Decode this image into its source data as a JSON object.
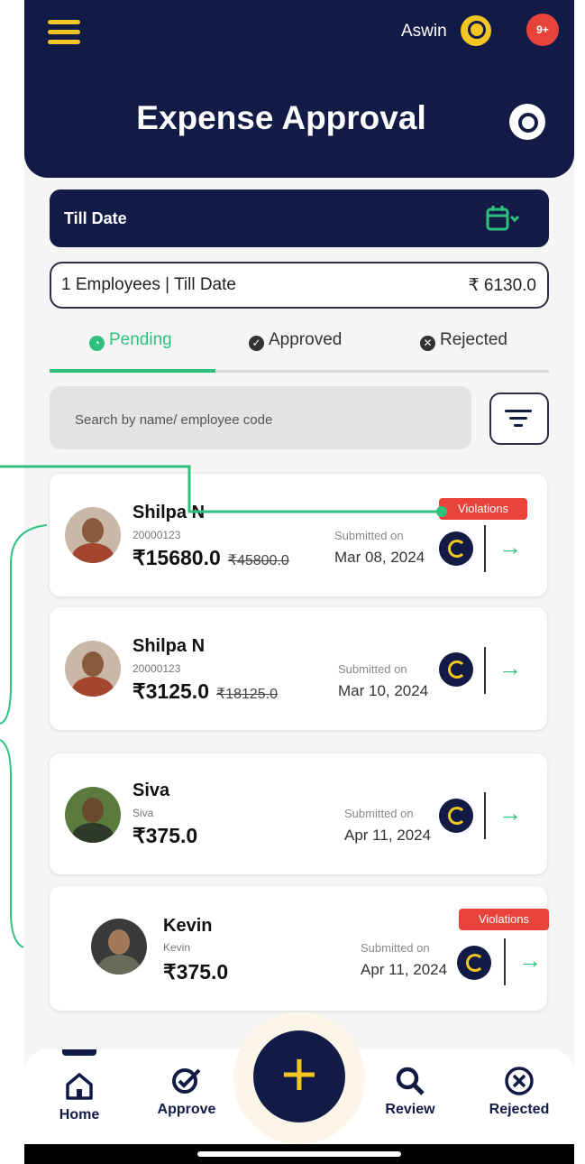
{
  "header": {
    "user_name": "Aswin",
    "notification_badge": "9+",
    "title": "Expense Approval",
    "accent": "#f3c623",
    "brand": "#121b45"
  },
  "date_filter": {
    "label": "Till Date",
    "icon": "calendar-icon"
  },
  "summary": {
    "left": "1 Employees | Till Date",
    "right": "₹ 6130.0"
  },
  "tabs": [
    {
      "label": "Pending",
      "icon": "clock-icon",
      "active": true
    },
    {
      "label": "Approved",
      "icon": "check-circle-icon",
      "active": false
    },
    {
      "label": "Rejected",
      "icon": "x-circle-icon",
      "active": false
    }
  ],
  "search": {
    "placeholder": "Search by name/ employee code"
  },
  "cards": [
    {
      "name": "Shilpa N",
      "code": "20000123",
      "amount": "₹15680.0",
      "original": "₹45800.0",
      "submitted_label": "Submitted on",
      "date": "Mar 08, 2024",
      "violation": "Violations"
    },
    {
      "name": "Shilpa N",
      "code": "20000123",
      "amount": "₹3125.0",
      "original": "₹18125.0",
      "submitted_label": "Submitted on",
      "date": "Mar 10, 2024",
      "violation": ""
    },
    {
      "name": "Siva",
      "code": "Siva",
      "amount": "₹375.0",
      "original": "",
      "submitted_label": "Submitted on",
      "date": "Apr 11, 2024",
      "violation": ""
    },
    {
      "name": "Kevin",
      "code": "Kevin",
      "amount": "₹375.0",
      "original": "",
      "submitted_label": "Submitted on",
      "date": "Apr 11, 2024",
      "violation": "Violations"
    }
  ],
  "nav": {
    "home": "Home",
    "approve": "Approve",
    "review": "Review",
    "rejected": "Rejected",
    "add": "+"
  },
  "colors": {
    "status_green": "#2ec17d",
    "violation_red": "#e8433a"
  }
}
